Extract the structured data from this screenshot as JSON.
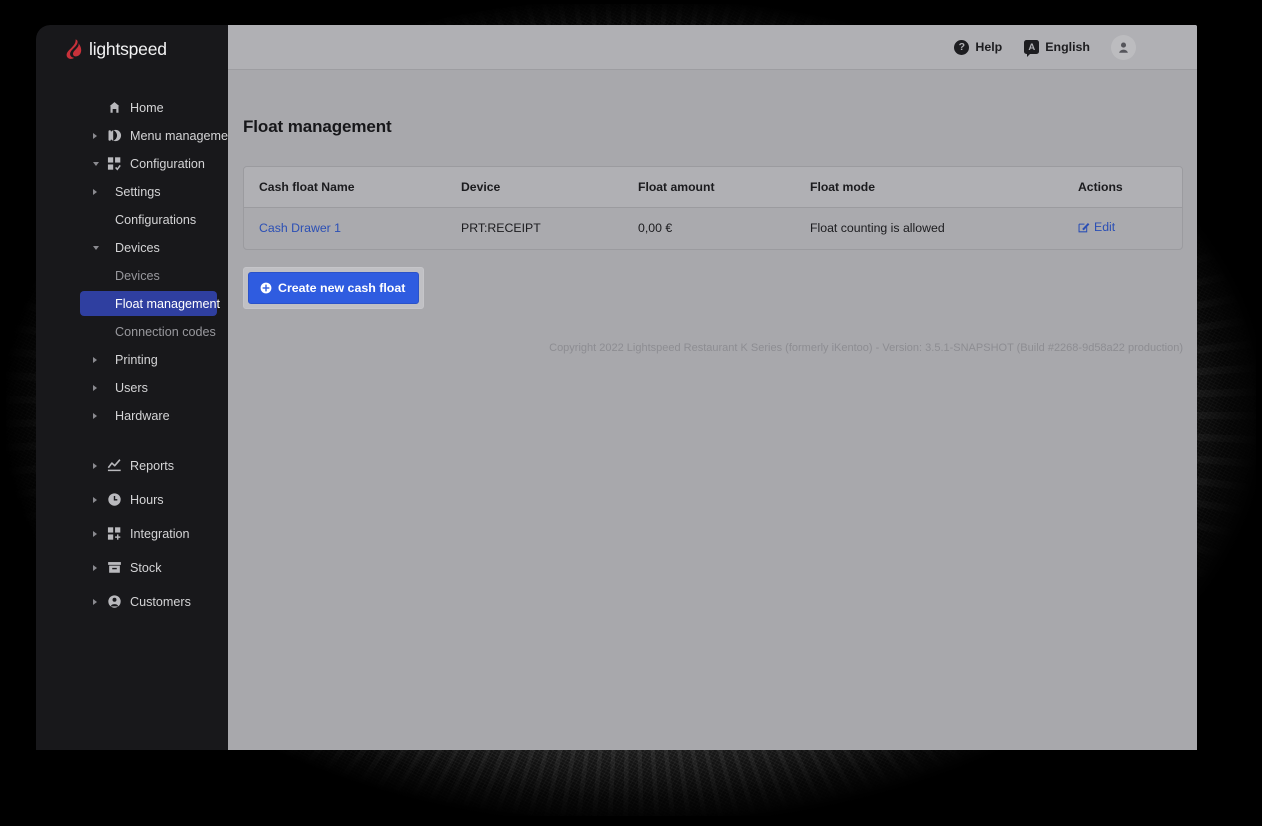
{
  "brand": {
    "logo_text": "lightspeed",
    "logo_icon": "flame-icon",
    "logo_color": "#c8313a"
  },
  "topbar": {
    "help": {
      "label": "Help",
      "icon": "question-circle-icon"
    },
    "language": {
      "label": "English",
      "icon": "translate-bubble-icon"
    },
    "account": {
      "icon": "user-avatar-icon"
    }
  },
  "sidebar": {
    "items": [
      {
        "label": "Home",
        "icon": "home-icon",
        "level": 1,
        "caret": "none",
        "selected": false
      },
      {
        "label": "Menu management",
        "icon": "menu-pie-icon",
        "level": 1,
        "caret": "closed",
        "selected": false
      },
      {
        "label": "Configuration",
        "icon": "grid-check-icon",
        "level": 1,
        "caret": "open",
        "selected": false
      },
      {
        "label": "Settings",
        "icon": "none",
        "level": 2,
        "caret": "closed",
        "selected": false
      },
      {
        "label": "Configurations",
        "icon": "none",
        "level": 2,
        "caret": "none",
        "selected": false
      },
      {
        "label": "Devices",
        "icon": "none",
        "level": 2,
        "caret": "open",
        "selected": false
      },
      {
        "label": "Devices",
        "icon": "none",
        "level": 3,
        "caret": "none",
        "selected": false
      },
      {
        "label": "Float management",
        "icon": "none",
        "level": 3,
        "caret": "none",
        "selected": true
      },
      {
        "label": "Connection codes",
        "icon": "none",
        "level": 3,
        "caret": "none",
        "selected": false
      },
      {
        "label": "Printing",
        "icon": "none",
        "level": 2,
        "caret": "closed",
        "selected": false
      },
      {
        "label": "Users",
        "icon": "none",
        "level": 2,
        "caret": "closed",
        "selected": false
      },
      {
        "label": "Hardware",
        "icon": "none",
        "level": 2,
        "caret": "closed",
        "selected": false
      },
      {
        "label": "Reports",
        "icon": "chart-line-icon",
        "level": 1,
        "caret": "closed",
        "selected": false
      },
      {
        "label": "Hours",
        "icon": "clock-icon",
        "level": 1,
        "caret": "closed",
        "selected": false
      },
      {
        "label": "Integration",
        "icon": "grid-plus-icon",
        "level": 1,
        "caret": "closed",
        "selected": false
      },
      {
        "label": "Stock",
        "icon": "box-icon",
        "level": 1,
        "caret": "closed",
        "selected": false
      },
      {
        "label": "Customers",
        "icon": "user-circle-icon",
        "level": 1,
        "caret": "closed",
        "selected": false
      }
    ],
    "selected_color": "#2f3fa0"
  },
  "page": {
    "title": "Float management"
  },
  "table": {
    "columns": [
      "Cash float Name",
      "Device",
      "Float amount",
      "Float mode",
      "Actions"
    ],
    "rows": [
      {
        "name": "Cash Drawer 1",
        "device": "PRT:RECEIPT",
        "amount": "0,00 €",
        "mode": "Float counting is allowed",
        "action_label": "Edit",
        "action_icon": "pencil-square-icon"
      }
    ],
    "link_color": "#2b4fb5"
  },
  "actions": {
    "create_button": {
      "label": "Create new cash float",
      "icon": "plus-circle-icon",
      "color": "#2f5ce0",
      "focused": true
    }
  },
  "footer": {
    "copyright": "Copyright 2022 Lightspeed Restaurant K Series (formerly iKentoo) - Version: 3.5.1-SNAPSHOT (Build #2268-9d58a22 production)"
  }
}
